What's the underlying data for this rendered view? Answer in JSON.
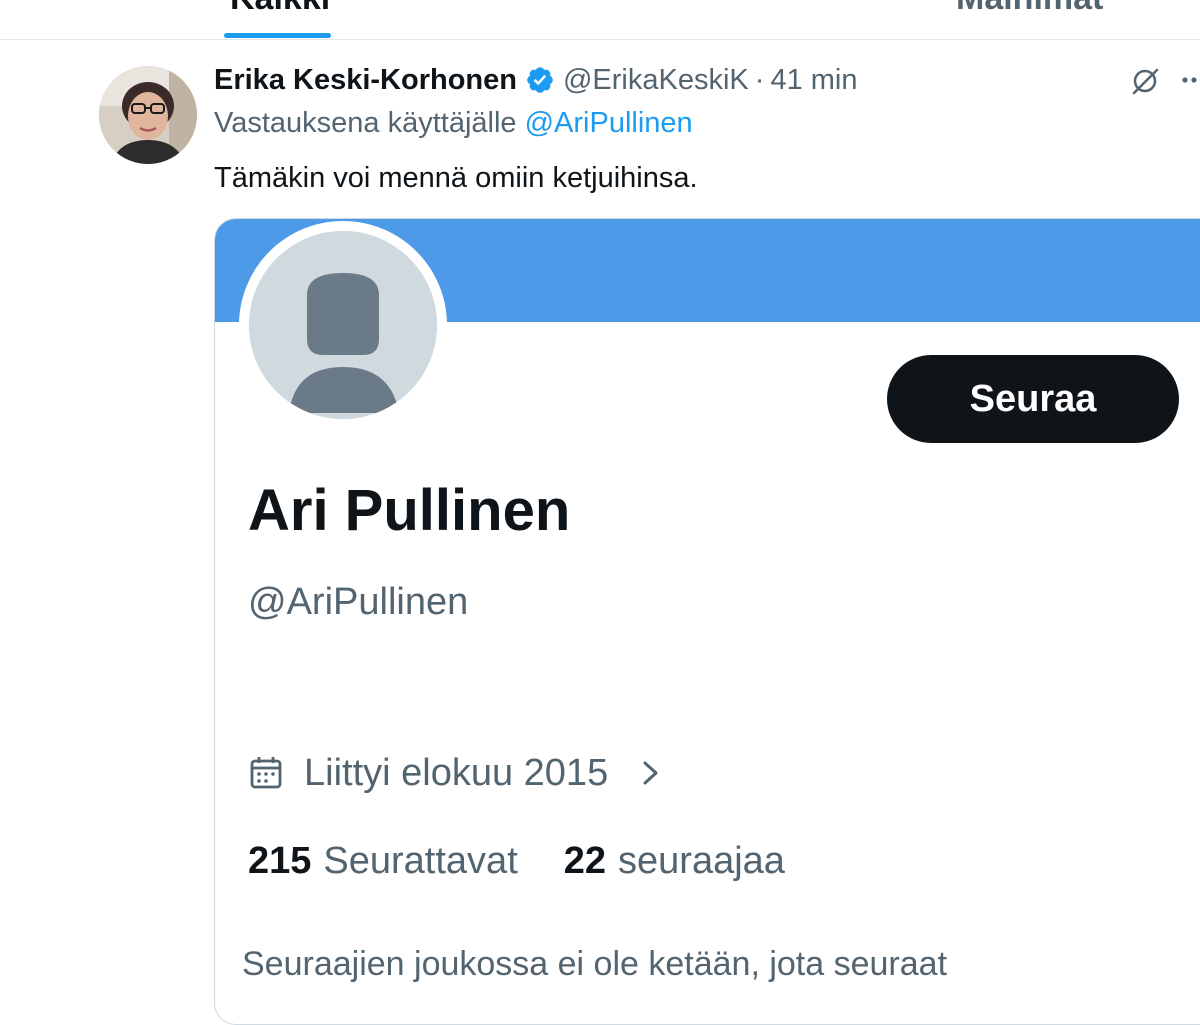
{
  "tabs": {
    "all_label": "Kaikki",
    "ads_label": "Mainimat"
  },
  "tweet": {
    "author_name": "Erika Keski-Korhonen",
    "author_handle": "@ErikaKeskiK",
    "separator": "·",
    "time": "41 min",
    "reply_prefix": "Vastauksena käyttäjälle",
    "reply_to": "@AriPullinen",
    "text": "Tämäkin voi mennä omiin ketjuihinsa."
  },
  "profile_card": {
    "follow_label": "Seuraa",
    "name": "Ari Pullinen",
    "handle": "@AriPullinen",
    "joined": "Liittyi elokuu 2015",
    "following_count": "215",
    "following_label": "Seurattavat",
    "followers_count": "22",
    "followers_label": "seuraajaa",
    "mutual_text": "Seuraajien joukossa ei ole ketään, jota seuraat"
  },
  "colors": {
    "accent": "#1d9bf0",
    "banner": "#4d9be8",
    "text_primary": "#0f1419",
    "text_secondary": "#536471",
    "follow_button_bg": "#0f1419"
  },
  "icons": {
    "verified": "verified-badge-icon",
    "grok": "grok-icon",
    "more": "more-icon",
    "calendar": "calendar-icon",
    "chevron": "chevron-right-icon",
    "default_avatar": "default-avatar-icon"
  }
}
